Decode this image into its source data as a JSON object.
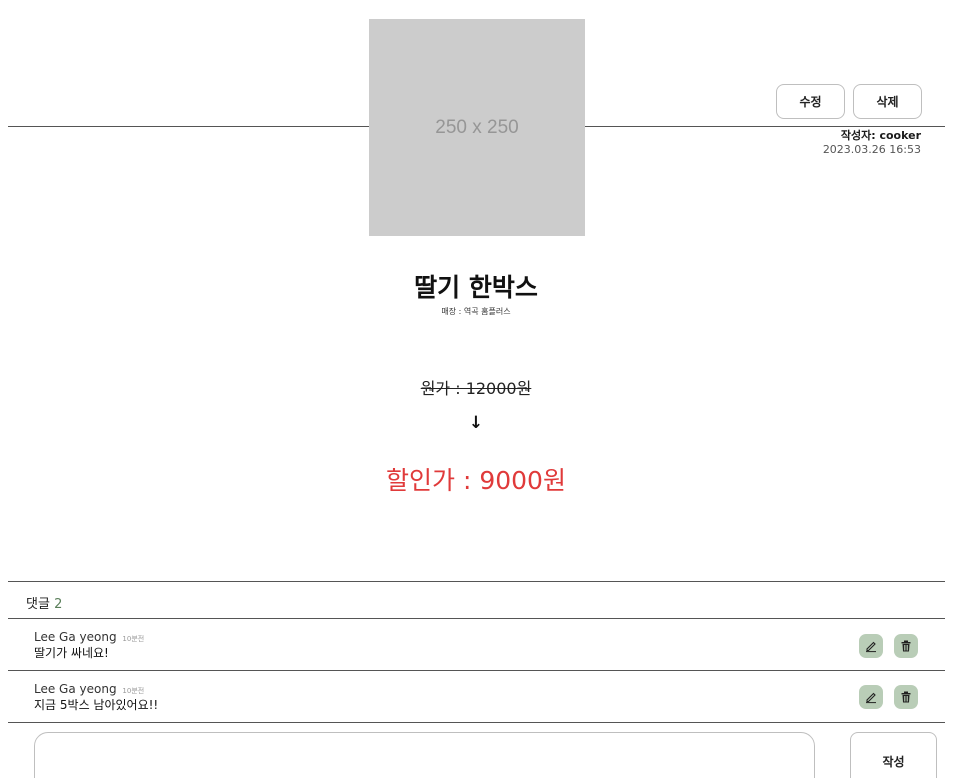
{
  "post": {
    "image_placeholder": "250 x 250",
    "edit_label": "수정",
    "delete_label": "삭제",
    "author_line": "작성자: cooker",
    "date": "2023.03.26 16:53",
    "title": "딸기 한박스",
    "store": "매장 : 역곡 홈플러스",
    "original_price": "원가 : 12000원",
    "arrow": "↓",
    "sale_price": "할인가 : 9000원"
  },
  "comments": {
    "header_label": "댓글",
    "count": "2",
    "items": [
      {
        "author": "Lee Ga yeong",
        "time_ago": "10분전",
        "text": "딸기가 싸네요!",
        "edit_icon": "pencil-icon",
        "delete_icon": "trash-icon"
      },
      {
        "author": "Lee Ga yeong",
        "time_ago": "10분전",
        "text": "지금 5박스 남아있어요!!",
        "edit_icon": "pencil-icon",
        "delete_icon": "trash-icon"
      }
    ],
    "submit_label": "작성"
  },
  "colors": {
    "sale_price": "#e03a3a",
    "icon_button_bg": "#b9cdb7",
    "image_placeholder_bg": "#cccccc"
  }
}
